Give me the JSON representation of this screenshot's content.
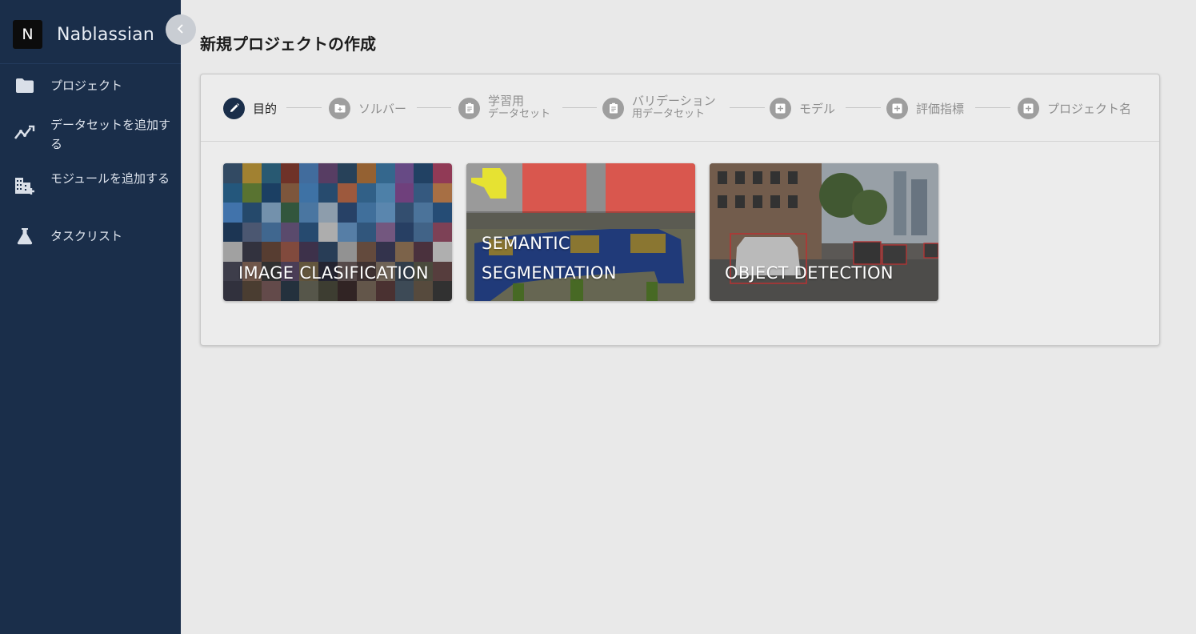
{
  "sidebar": {
    "logo_letter": "N",
    "app_name": "Nablassian",
    "items": [
      {
        "label": "プロジェクト",
        "icon": "folder-icon"
      },
      {
        "label": "データセットを追加する",
        "icon": "trending-up-icon"
      },
      {
        "label": "モジュールを追加する",
        "icon": "domain-add-icon"
      },
      {
        "label": "タスクリスト",
        "icon": "flask-icon"
      }
    ]
  },
  "header": {
    "title": "新規プロジェクトの作成"
  },
  "stepper": {
    "steps": [
      {
        "label": "目的",
        "sub": "",
        "icon": "pencil-icon",
        "active": true
      },
      {
        "label": "ソルバー",
        "sub": "",
        "icon": "folder-plus-icon",
        "active": false
      },
      {
        "label": "学習用",
        "sub": "データセット",
        "icon": "clipboard-icon",
        "active": false
      },
      {
        "label": "バリデーション",
        "sub": "用データセット",
        "icon": "clipboard-icon",
        "active": false
      },
      {
        "label": "モデル",
        "sub": "",
        "icon": "add-box-icon",
        "active": false
      },
      {
        "label": "評価指標",
        "sub": "",
        "icon": "add-box-icon",
        "active": false
      },
      {
        "label": "プロジェクト名",
        "sub": "",
        "icon": "add-box-icon",
        "active": false
      }
    ]
  },
  "cards": [
    {
      "label": "IMAGE CLASIFICATION"
    },
    {
      "label": "SEMANTIC SEGMENTATION",
      "line1": "SEMANTIC",
      "line2": "SEGMENTATION"
    },
    {
      "label": "OBJECT DETECTION"
    }
  ],
  "colors": {
    "sidebar": "#1a2e4a",
    "active_step": "#1a2e4a",
    "inactive_step": "#9e9e9e"
  }
}
